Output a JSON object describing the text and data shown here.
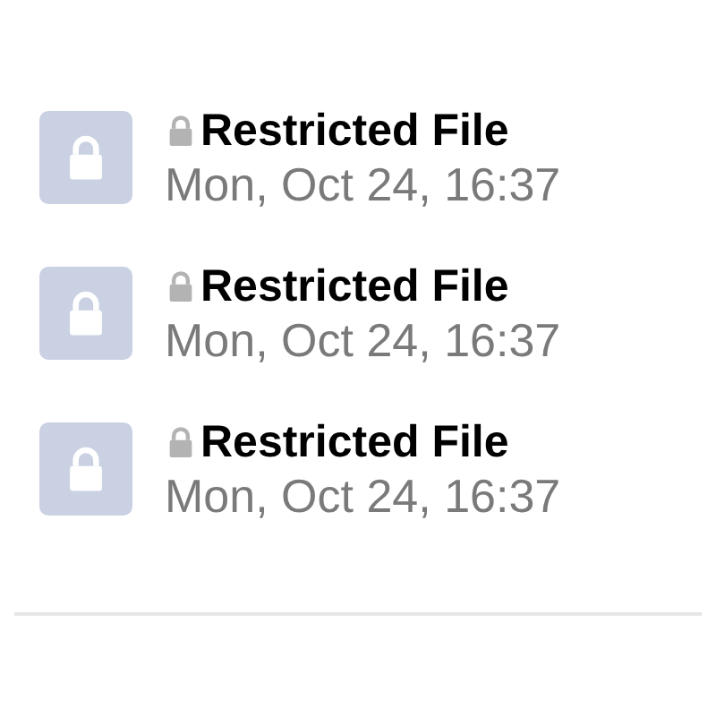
{
  "files": [
    {
      "title": "Restricted File",
      "restricted": true,
      "date": "Mon, Oct 24, 16:37"
    },
    {
      "title": "Restricted File",
      "restricted": true,
      "date": "Mon, Oct 24, 16:37"
    },
    {
      "title": "Restricted File",
      "restricted": true,
      "date": "Mon, Oct 24, 16:37"
    }
  ]
}
